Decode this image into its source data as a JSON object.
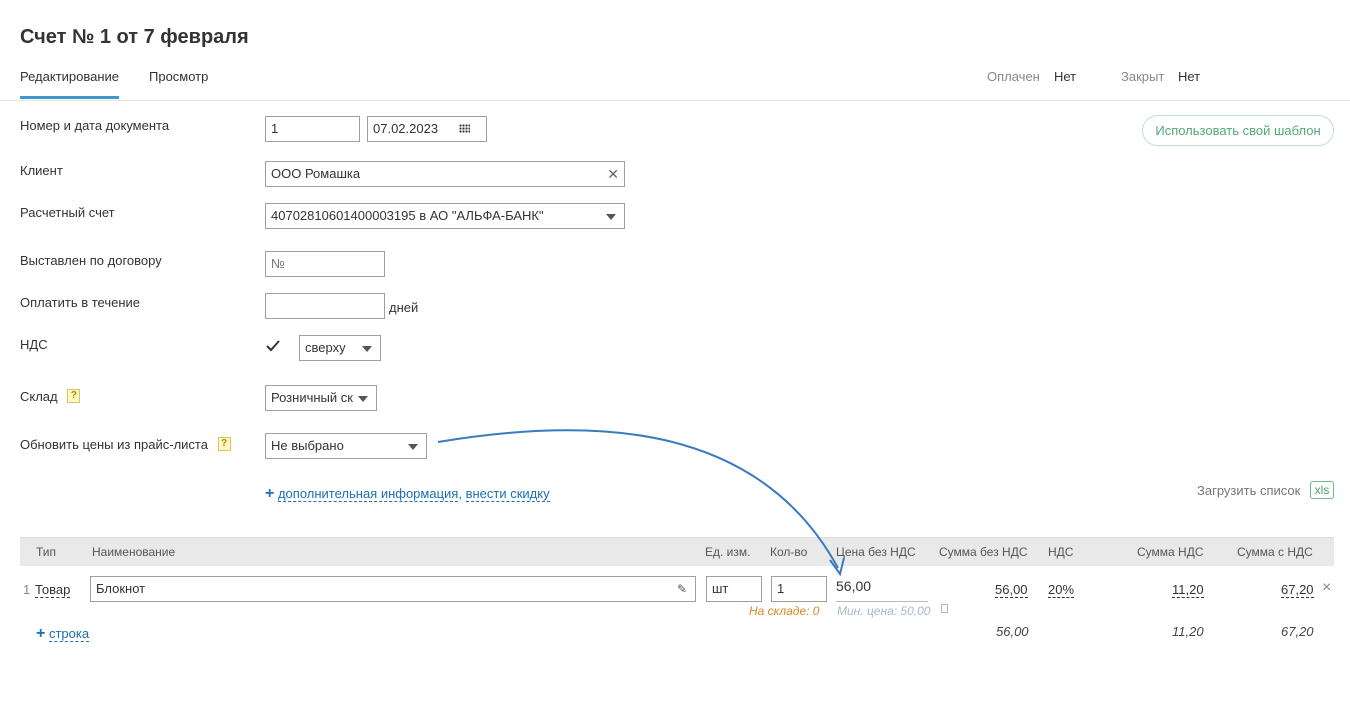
{
  "title": "Счет № 1 от 7 февраля",
  "tabs": [
    {
      "label": "Редактирование",
      "active": true
    },
    {
      "label": "Просмотр",
      "active": false
    }
  ],
  "status": {
    "paid_label": "Оплачен",
    "paid_value": "Нет",
    "closed_label": "Закрыт",
    "closed_value": "Нет"
  },
  "template_button": "Использовать свой шаблон",
  "form": {
    "doc_label": "Номер и дата документа",
    "doc_number": "1",
    "doc_date": "07.02.2023",
    "client_label": "Клиент",
    "client_value": "ООО Ромашка",
    "account_label": "Расчетный счет",
    "account_value": "40702810601400003195 в АО \"АЛЬФА-БАНК\"",
    "contract_label": "Выставлен по договору",
    "contract_placeholder": "№",
    "pay_within_label": "Оплатить в течение",
    "pay_within_value": "",
    "days_suffix": "дней",
    "vat_label": "НДС",
    "vat_checked": true,
    "vat_mode": "сверху",
    "warehouse_label": "Склад",
    "warehouse_value": "Розничный ск",
    "pricelist_label": "Обновить цены из прайс-листа",
    "pricelist_value": "Не выбрано",
    "help_mark": "?"
  },
  "extra": {
    "plus": "+",
    "more_info_link": "дополнительная информация",
    "comma": ",",
    "discount_link": "внести скидку"
  },
  "load_list": {
    "label": "Загрузить список",
    "xls": "xls"
  },
  "table": {
    "headers": [
      "Тип",
      "Наименование",
      "Ед. изм.",
      "Кол-во",
      "Цена без НДС",
      "Сумма без НДС",
      "НДС",
      "Сумма НДС",
      "Сумма с НДС"
    ],
    "rows": [
      {
        "num": "1",
        "type": "Товар",
        "name": "Блокнот",
        "unit": "шт",
        "qty": "1",
        "price": "56,00",
        "in_stock": "На складе: 0",
        "min_price": "Мин. цена: 50,00",
        "sum_no_vat": "56,00",
        "vat_rate": "20%",
        "vat_sum": "11,20",
        "sum_with_vat": "67,20"
      }
    ],
    "totals": {
      "sum_no_vat": "56,00",
      "vat_sum": "11,20",
      "sum_with_vat": "67,20"
    },
    "add_row_plus": "+",
    "add_row": "строка",
    "remove_icon": "×"
  },
  "colors": {
    "accent": "#3c9ad1",
    "link": "#1c6fb1",
    "green": "#52a978",
    "orange": "#d98a1f",
    "arrow": "#3a7bbf"
  }
}
